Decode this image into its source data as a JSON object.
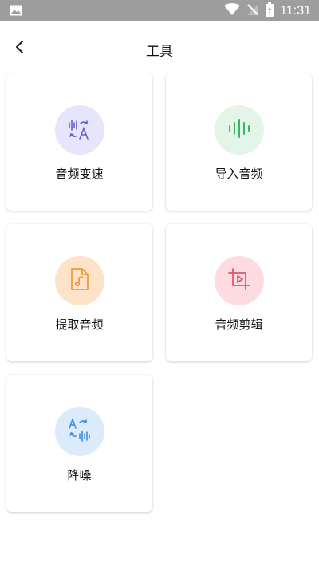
{
  "status_bar": {
    "time": "11:31"
  },
  "header": {
    "title": "工具"
  },
  "tools": [
    {
      "label": "音频变速",
      "icon": "voice-translate-icon",
      "color": "#6a5bd6",
      "bg": "#e7e5fb"
    },
    {
      "label": "导入音频",
      "icon": "audio-wave-icon",
      "color": "#3fb36a",
      "bg": "#e3f5e8"
    },
    {
      "label": "提取音频",
      "icon": "audio-file-icon",
      "color": "#f29a3a",
      "bg": "#fde3c7"
    },
    {
      "label": "音频剪辑",
      "icon": "crop-play-icon",
      "color": "#e0566c",
      "bg": "#fddbe0"
    },
    {
      "label": "降噪",
      "icon": "noise-reduce-icon",
      "color": "#3d8ee0",
      "bg": "#dcebfb"
    }
  ]
}
